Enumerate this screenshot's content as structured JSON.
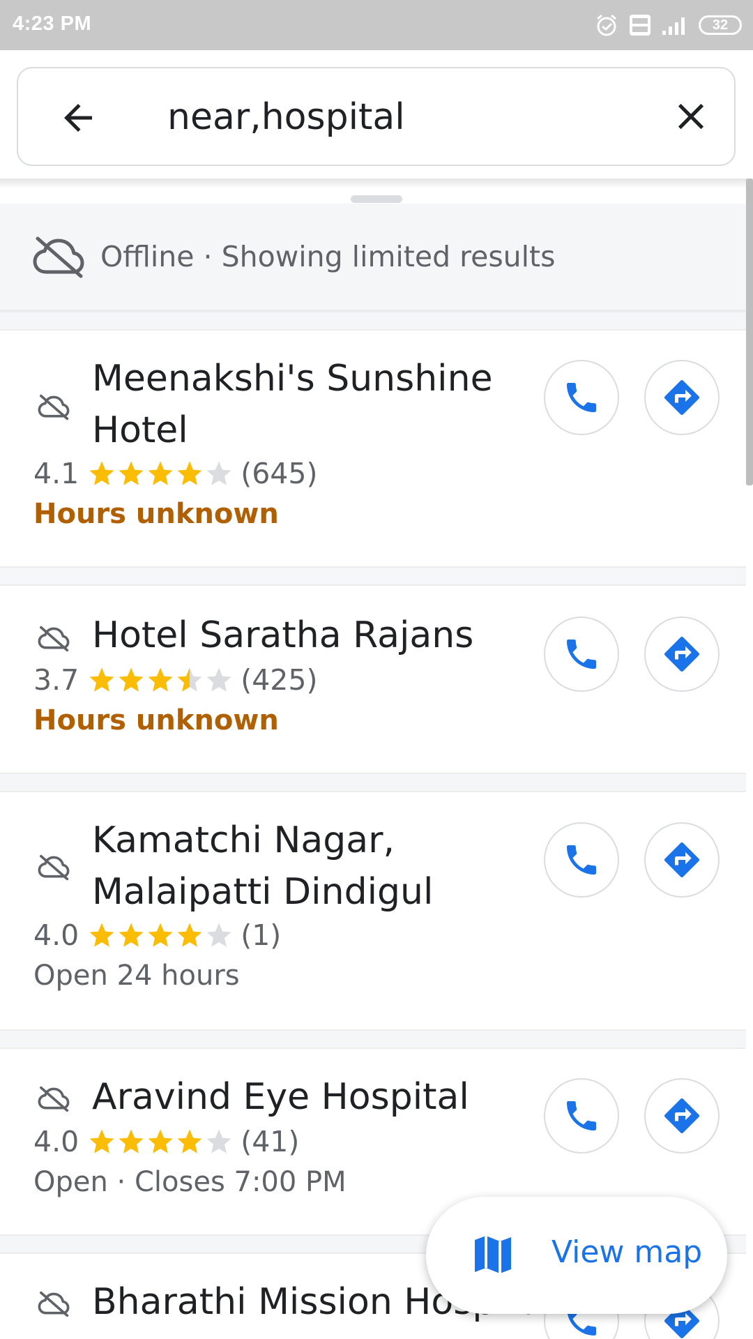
{
  "status_bar": {
    "time": "4:23 PM",
    "battery": "32",
    "icons": [
      "alarm-icon",
      "volte-icon",
      "signal-icon",
      "battery-icon"
    ]
  },
  "search": {
    "query": "near,hospital",
    "back_icon": "arrow-left-icon",
    "clear_icon": "close-icon"
  },
  "offline_banner": {
    "text": "Offline · Showing limited results",
    "icon": "cloud-off-icon"
  },
  "results": [
    {
      "name_line1": "Meenakshi's Sunshine",
      "name_line2": "Hotel",
      "rating": "4.1",
      "rating_value": 4.1,
      "reviews": "(645)",
      "status": "Hours unknown",
      "status_type": "warning"
    },
    {
      "name_line1": "Hotel Saratha Rajans",
      "name_line2": "",
      "rating": "3.7",
      "rating_value": 3.7,
      "reviews": "(425)",
      "status": "Hours unknown",
      "status_type": "warning"
    },
    {
      "name_line1": "Kamatchi Nagar,",
      "name_line2": "Malaipatti Dindigul",
      "rating": "4.0",
      "rating_value": 4.0,
      "reviews": "(1)",
      "status": "Open 24 hours",
      "status_type": "normal"
    },
    {
      "name_line1": "Aravind Eye Hospital",
      "name_line2": "",
      "rating": "4.0",
      "rating_value": 4.0,
      "reviews": "(41)",
      "status": "Open · Closes 7:00 PM",
      "status_type": "normal"
    },
    {
      "name_line1": "Bharathi Mission Hospital",
      "name_line2": ""
    }
  ],
  "actions": {
    "call_icon": "phone-icon",
    "directions_icon": "directions-icon"
  },
  "view_map": {
    "label": "View map",
    "icon": "map-icon"
  },
  "colors": {
    "star_filled": "#fbbc04",
    "star_empty": "#dadce0",
    "accent_blue": "#1a73e8",
    "warning": "#b06000",
    "text_primary": "#202124",
    "text_secondary": "#5f6368"
  }
}
